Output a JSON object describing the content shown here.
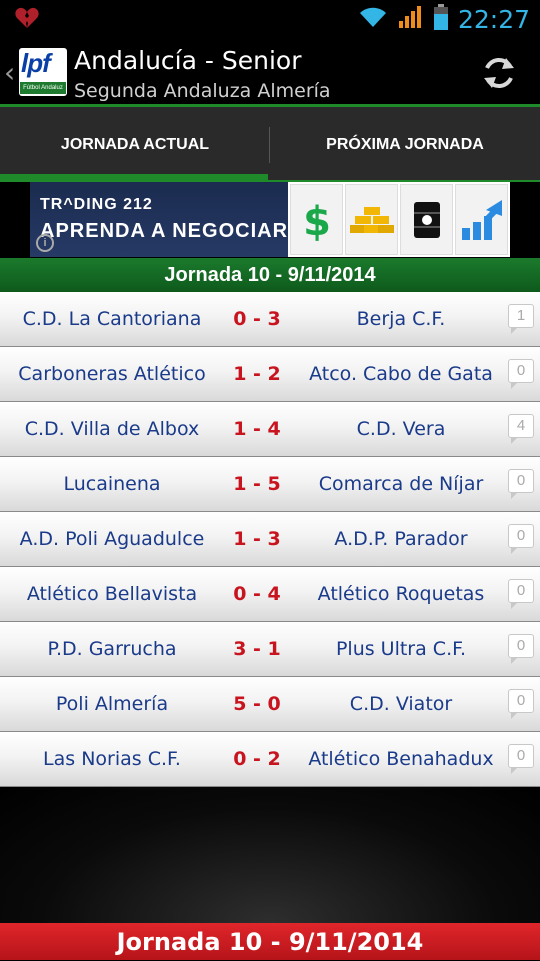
{
  "status_bar": {
    "time": "22:27",
    "icons": [
      "broken-heart-icon",
      "wifi-icon",
      "signal-icon",
      "battery-icon"
    ]
  },
  "action_bar": {
    "logo_text": "lpf",
    "logo_subtext": "Fútbol Andaluz",
    "title": "Andalucía - Senior",
    "subtitle": "Segunda Andaluza Almería"
  },
  "tabs": [
    {
      "label": "JORNADA ACTUAL",
      "selected": true
    },
    {
      "label": "PRÓXIMA JORNADA",
      "selected": false
    }
  ],
  "ad": {
    "brand": "TR^DING 212",
    "cta": "APRENDA A NEGOCIAR",
    "icons": [
      "dollar-icon",
      "gold-bars-icon",
      "oil-barrel-icon",
      "growth-chart-icon"
    ]
  },
  "section_header": "Jornada 10 - 9/11/2014",
  "matches": [
    {
      "home": "C.D. La Cantoriana",
      "score": "0 - 3",
      "away": "Berja C.F.",
      "comments": "1"
    },
    {
      "home": "Carboneras Atlético",
      "score": "1 - 2",
      "away": "Atco. Cabo de Gata",
      "comments": "0"
    },
    {
      "home": "C.D. Villa de Albox",
      "score": "1 - 4",
      "away": "C.D. Vera",
      "comments": "4"
    },
    {
      "home": "Lucainena",
      "score": "1 - 5",
      "away": "Comarca de Níjar",
      "comments": "0"
    },
    {
      "home": "A.D. Poli Aguadulce",
      "score": "1 - 3",
      "away": "A.D.P. Parador",
      "comments": "0"
    },
    {
      "home": "Atlético Bellavista",
      "score": "0 - 4",
      "away": "Atlético Roquetas",
      "comments": "0"
    },
    {
      "home": "P.D. Garrucha",
      "score": "3 - 1",
      "away": "Plus Ultra C.F.",
      "comments": "0"
    },
    {
      "home": "Poli Almería",
      "score": "5 - 0",
      "away": "C.D. Viator",
      "comments": "0"
    },
    {
      "home": "Las Norias C.F.",
      "score": "0 - 2",
      "away": "Atlético Benahadux",
      "comments": "0"
    }
  ],
  "footer": "Jornada 10 - 9/11/2014",
  "colors": {
    "accent_green": "#1f8a2a",
    "score_red": "#c8141e",
    "team_blue": "#1a3a8a",
    "time_blue": "#33b5e5",
    "footer_red": "#d11f24"
  }
}
